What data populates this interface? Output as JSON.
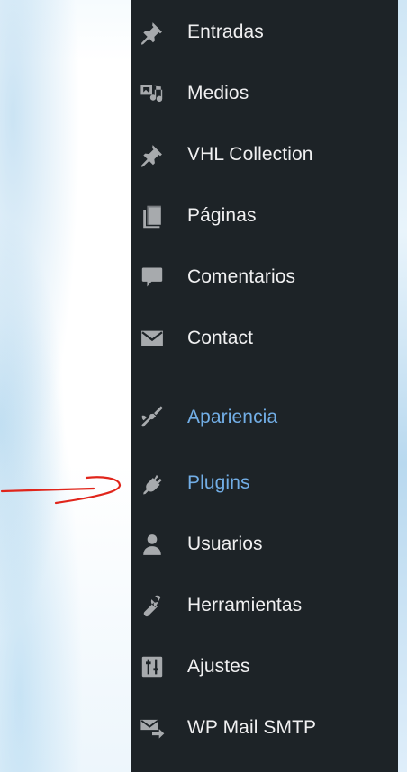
{
  "menu": {
    "items": [
      {
        "label": "Entradas",
        "icon": "pin-icon"
      },
      {
        "label": "Medios",
        "icon": "media-icon"
      },
      {
        "label": "VHL Collection",
        "icon": "pin-icon"
      },
      {
        "label": "Páginas",
        "icon": "pages-icon"
      },
      {
        "label": "Comentarios",
        "icon": "comment-icon"
      },
      {
        "label": "Contact",
        "icon": "envelope-icon"
      },
      {
        "label": "Apariencia",
        "icon": "paintbrush-icon"
      },
      {
        "label": "Plugins",
        "icon": "plugin-icon"
      },
      {
        "label": "Usuarios",
        "icon": "user-icon"
      },
      {
        "label": "Herramientas",
        "icon": "wrench-icon"
      },
      {
        "label": "Ajustes",
        "icon": "settings-sliders-icon"
      },
      {
        "label": "WP Mail SMTP",
        "icon": "mail-send-icon"
      }
    ]
  },
  "colors": {
    "sidebar_bg": "#1d2327",
    "text": "#f0f0f1",
    "icon": "#a7aaad",
    "highlight_text": "#72aee6",
    "annotation_arrow": "#e0251b"
  }
}
